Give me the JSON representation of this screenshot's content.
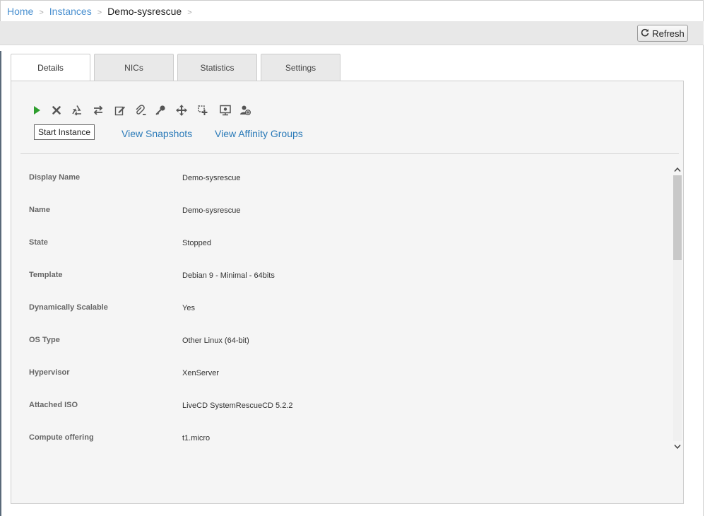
{
  "breadcrumb": {
    "home": "Home",
    "instances": "Instances",
    "current": "Demo-sysrescue",
    "separator": ">"
  },
  "toolbar": {
    "refresh_label": "Refresh"
  },
  "tabs": [
    {
      "label": "Details",
      "active": true
    },
    {
      "label": "NICs",
      "active": false
    },
    {
      "label": "Statistics",
      "active": false
    },
    {
      "label": "Settings",
      "active": false
    }
  ],
  "actions": {
    "tooltip": "Start Instance",
    "icons": [
      "start-icon",
      "destroy-icon",
      "recycle-icon",
      "migrate-icon",
      "edit-icon",
      "detach-iso-icon",
      "key-icon",
      "move-icon",
      "scale-icon",
      "console-icon",
      "assign-user-icon"
    ],
    "colors": {
      "start": "#2e9e2e",
      "icon": "#555555"
    }
  },
  "links": {
    "snapshots": "View Snapshots",
    "affinity": "View Affinity Groups"
  },
  "details": [
    {
      "label": "Display Name",
      "value": "Demo-sysrescue"
    },
    {
      "label": "Name",
      "value": "Demo-sysrescue"
    },
    {
      "label": "State",
      "value": "Stopped"
    },
    {
      "label": "Template",
      "value": "Debian 9 - Minimal - 64bits"
    },
    {
      "label": "Dynamically Scalable",
      "value": "Yes"
    },
    {
      "label": "OS Type",
      "value": "Other Linux (64-bit)"
    },
    {
      "label": "Hypervisor",
      "value": "XenServer"
    },
    {
      "label": "Attached ISO",
      "value": "LiveCD SystemRescueCD 5.2.2"
    },
    {
      "label": "Compute offering",
      "value": "t1.micro"
    }
  ]
}
